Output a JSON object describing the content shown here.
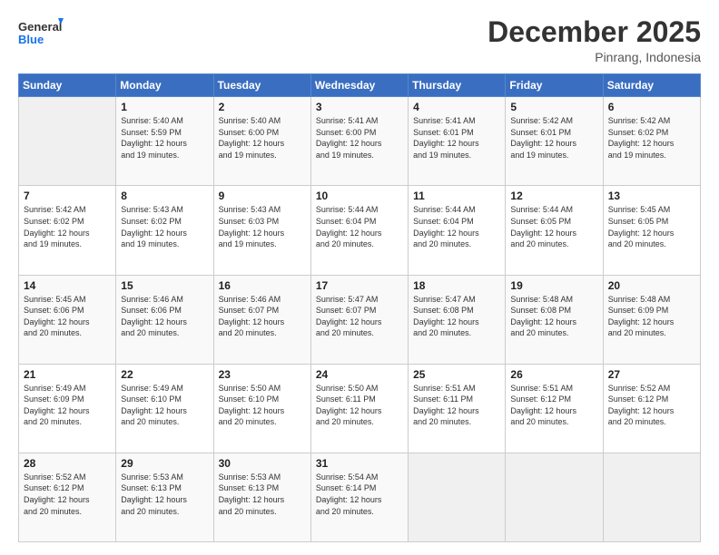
{
  "logo": {
    "line1": "General",
    "line2": "Blue"
  },
  "header": {
    "month": "December 2025",
    "location": "Pinrang, Indonesia"
  },
  "weekdays": [
    "Sunday",
    "Monday",
    "Tuesday",
    "Wednesday",
    "Thursday",
    "Friday",
    "Saturday"
  ],
  "weeks": [
    [
      {
        "day": "",
        "info": ""
      },
      {
        "day": "1",
        "info": "Sunrise: 5:40 AM\nSunset: 5:59 PM\nDaylight: 12 hours\nand 19 minutes."
      },
      {
        "day": "2",
        "info": "Sunrise: 5:40 AM\nSunset: 6:00 PM\nDaylight: 12 hours\nand 19 minutes."
      },
      {
        "day": "3",
        "info": "Sunrise: 5:41 AM\nSunset: 6:00 PM\nDaylight: 12 hours\nand 19 minutes."
      },
      {
        "day": "4",
        "info": "Sunrise: 5:41 AM\nSunset: 6:01 PM\nDaylight: 12 hours\nand 19 minutes."
      },
      {
        "day": "5",
        "info": "Sunrise: 5:42 AM\nSunset: 6:01 PM\nDaylight: 12 hours\nand 19 minutes."
      },
      {
        "day": "6",
        "info": "Sunrise: 5:42 AM\nSunset: 6:02 PM\nDaylight: 12 hours\nand 19 minutes."
      }
    ],
    [
      {
        "day": "7",
        "info": "Sunrise: 5:42 AM\nSunset: 6:02 PM\nDaylight: 12 hours\nand 19 minutes."
      },
      {
        "day": "8",
        "info": "Sunrise: 5:43 AM\nSunset: 6:02 PM\nDaylight: 12 hours\nand 19 minutes."
      },
      {
        "day": "9",
        "info": "Sunrise: 5:43 AM\nSunset: 6:03 PM\nDaylight: 12 hours\nand 19 minutes."
      },
      {
        "day": "10",
        "info": "Sunrise: 5:44 AM\nSunset: 6:04 PM\nDaylight: 12 hours\nand 20 minutes."
      },
      {
        "day": "11",
        "info": "Sunrise: 5:44 AM\nSunset: 6:04 PM\nDaylight: 12 hours\nand 20 minutes."
      },
      {
        "day": "12",
        "info": "Sunrise: 5:44 AM\nSunset: 6:05 PM\nDaylight: 12 hours\nand 20 minutes."
      },
      {
        "day": "13",
        "info": "Sunrise: 5:45 AM\nSunset: 6:05 PM\nDaylight: 12 hours\nand 20 minutes."
      }
    ],
    [
      {
        "day": "14",
        "info": "Sunrise: 5:45 AM\nSunset: 6:06 PM\nDaylight: 12 hours\nand 20 minutes."
      },
      {
        "day": "15",
        "info": "Sunrise: 5:46 AM\nSunset: 6:06 PM\nDaylight: 12 hours\nand 20 minutes."
      },
      {
        "day": "16",
        "info": "Sunrise: 5:46 AM\nSunset: 6:07 PM\nDaylight: 12 hours\nand 20 minutes."
      },
      {
        "day": "17",
        "info": "Sunrise: 5:47 AM\nSunset: 6:07 PM\nDaylight: 12 hours\nand 20 minutes."
      },
      {
        "day": "18",
        "info": "Sunrise: 5:47 AM\nSunset: 6:08 PM\nDaylight: 12 hours\nand 20 minutes."
      },
      {
        "day": "19",
        "info": "Sunrise: 5:48 AM\nSunset: 6:08 PM\nDaylight: 12 hours\nand 20 minutes."
      },
      {
        "day": "20",
        "info": "Sunrise: 5:48 AM\nSunset: 6:09 PM\nDaylight: 12 hours\nand 20 minutes."
      }
    ],
    [
      {
        "day": "21",
        "info": "Sunrise: 5:49 AM\nSunset: 6:09 PM\nDaylight: 12 hours\nand 20 minutes."
      },
      {
        "day": "22",
        "info": "Sunrise: 5:49 AM\nSunset: 6:10 PM\nDaylight: 12 hours\nand 20 minutes."
      },
      {
        "day": "23",
        "info": "Sunrise: 5:50 AM\nSunset: 6:10 PM\nDaylight: 12 hours\nand 20 minutes."
      },
      {
        "day": "24",
        "info": "Sunrise: 5:50 AM\nSunset: 6:11 PM\nDaylight: 12 hours\nand 20 minutes."
      },
      {
        "day": "25",
        "info": "Sunrise: 5:51 AM\nSunset: 6:11 PM\nDaylight: 12 hours\nand 20 minutes."
      },
      {
        "day": "26",
        "info": "Sunrise: 5:51 AM\nSunset: 6:12 PM\nDaylight: 12 hours\nand 20 minutes."
      },
      {
        "day": "27",
        "info": "Sunrise: 5:52 AM\nSunset: 6:12 PM\nDaylight: 12 hours\nand 20 minutes."
      }
    ],
    [
      {
        "day": "28",
        "info": "Sunrise: 5:52 AM\nSunset: 6:12 PM\nDaylight: 12 hours\nand 20 minutes."
      },
      {
        "day": "29",
        "info": "Sunrise: 5:53 AM\nSunset: 6:13 PM\nDaylight: 12 hours\nand 20 minutes."
      },
      {
        "day": "30",
        "info": "Sunrise: 5:53 AM\nSunset: 6:13 PM\nDaylight: 12 hours\nand 20 minutes."
      },
      {
        "day": "31",
        "info": "Sunrise: 5:54 AM\nSunset: 6:14 PM\nDaylight: 12 hours\nand 20 minutes."
      },
      {
        "day": "",
        "info": ""
      },
      {
        "day": "",
        "info": ""
      },
      {
        "day": "",
        "info": ""
      }
    ]
  ]
}
